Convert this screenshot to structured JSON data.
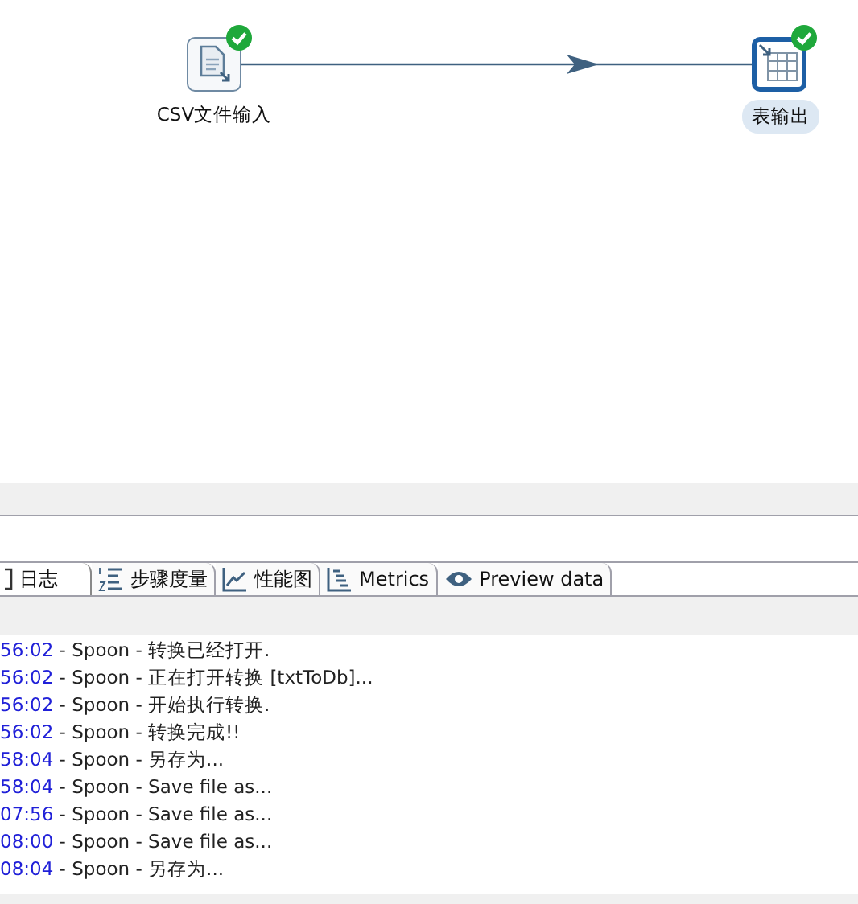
{
  "canvas": {
    "nodes": [
      {
        "label": "CSV文件输入",
        "kind": "file",
        "ok": true,
        "selected": false
      },
      {
        "label": "表输出",
        "kind": "table",
        "ok": true,
        "selected": true
      }
    ]
  },
  "tabs": [
    {
      "label": "日志",
      "kind": "log",
      "selected": true
    },
    {
      "label": "步骤度量",
      "kind": "list",
      "selected": false
    },
    {
      "label": "性能图",
      "kind": "chart",
      "selected": false
    },
    {
      "label": "Metrics",
      "kind": "metrics",
      "selected": false
    },
    {
      "label": "Preview data",
      "kind": "eye",
      "selected": false
    }
  ],
  "log": [
    {
      "time": "56:02",
      "text": " - Spoon - 转换已经打开."
    },
    {
      "time": "56:02",
      "text": " - Spoon - 正在打开转换 [txtToDb]..."
    },
    {
      "time": "56:02",
      "text": " - Spoon - 开始执行转换."
    },
    {
      "time": "56:02",
      "text": " - Spoon - 转换完成!!"
    },
    {
      "time": "58:04",
      "text": " - Spoon - 另存为..."
    },
    {
      "time": "58:04",
      "text": " - Spoon - Save file as..."
    },
    {
      "time": "07:56",
      "text": " - Spoon - Save file as..."
    },
    {
      "time": "08:00",
      "text": " - Spoon - Save file as..."
    },
    {
      "time": "08:04",
      "text": " - Spoon - 另存为..."
    }
  ]
}
